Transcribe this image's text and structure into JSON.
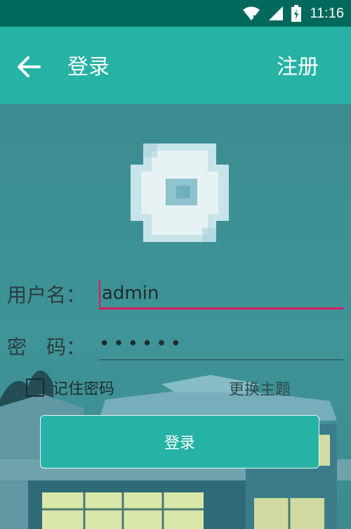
{
  "status_bar": {
    "time": "11:16",
    "icons": [
      "wifi-icon",
      "signal-icon",
      "battery-charging-icon"
    ]
  },
  "app_bar": {
    "title": "登录",
    "register_label": "注册"
  },
  "form": {
    "username_label": "用户名：",
    "username_value": "admin",
    "password_label": "密　码：",
    "password_value": "••••••",
    "remember_label": "记住密码",
    "remember_checked": false,
    "theme_label": "更换主题",
    "login_label": "登录"
  },
  "colors": {
    "status_bar": "#00695c",
    "app_bar": "#26b3a5",
    "accent": "#d81b60",
    "button": "#26b3a5"
  }
}
